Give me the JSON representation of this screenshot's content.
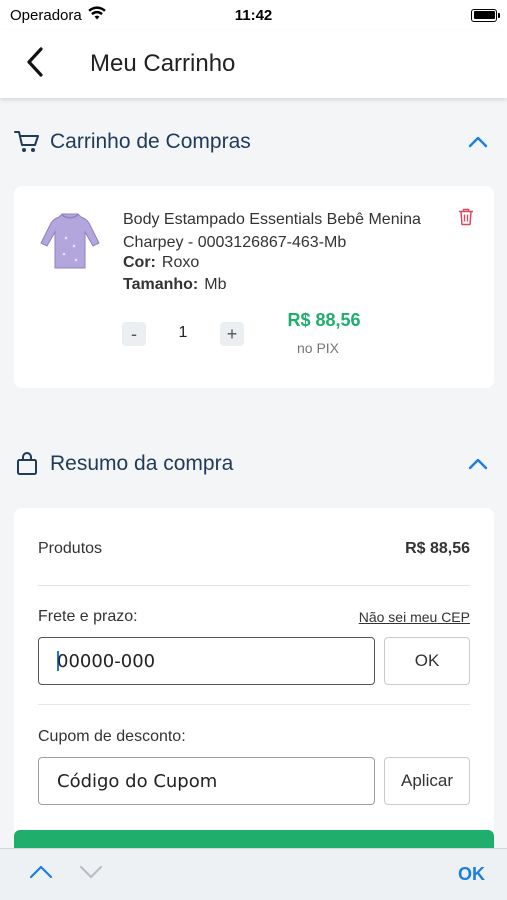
{
  "status_bar": {
    "carrier": "Operadora",
    "time": "11:42"
  },
  "header": {
    "title": "Meu Carrinho"
  },
  "cart_section": {
    "title": "Carrinho de Compras"
  },
  "cart_item": {
    "name": "Body Estampado Essentials Bebê Menina Charpey - 0003126867-463-Mb",
    "color_label": "Cor:",
    "color_value": "Roxo",
    "size_label": "Tamanho:",
    "size_value": "Mb",
    "qty_minus": "-",
    "quantity": "1",
    "qty_plus": "+",
    "price": "R$ 88,56",
    "price_note": "no PIX",
    "image_color": "#b3a6dc"
  },
  "summary_section": {
    "title": "Resumo da compra"
  },
  "summary": {
    "products_label": "Produtos",
    "products_value": "R$ 88,56",
    "shipping_label": "Frete e prazo:",
    "cep_link": "Não sei meu CEP",
    "cep_value": "00000-000",
    "cep_button": "OK",
    "coupon_label": "Cupom de desconto:",
    "coupon_placeholder": "Código do Cupom",
    "coupon_button": "Aplicar"
  },
  "keyboard_toolbar": {
    "done_label": "OK"
  },
  "colors": {
    "accent": "#1a7fe0",
    "price_green": "#1fae6b",
    "heading": "#1f3a5a",
    "delete_red": "#e0475a"
  }
}
